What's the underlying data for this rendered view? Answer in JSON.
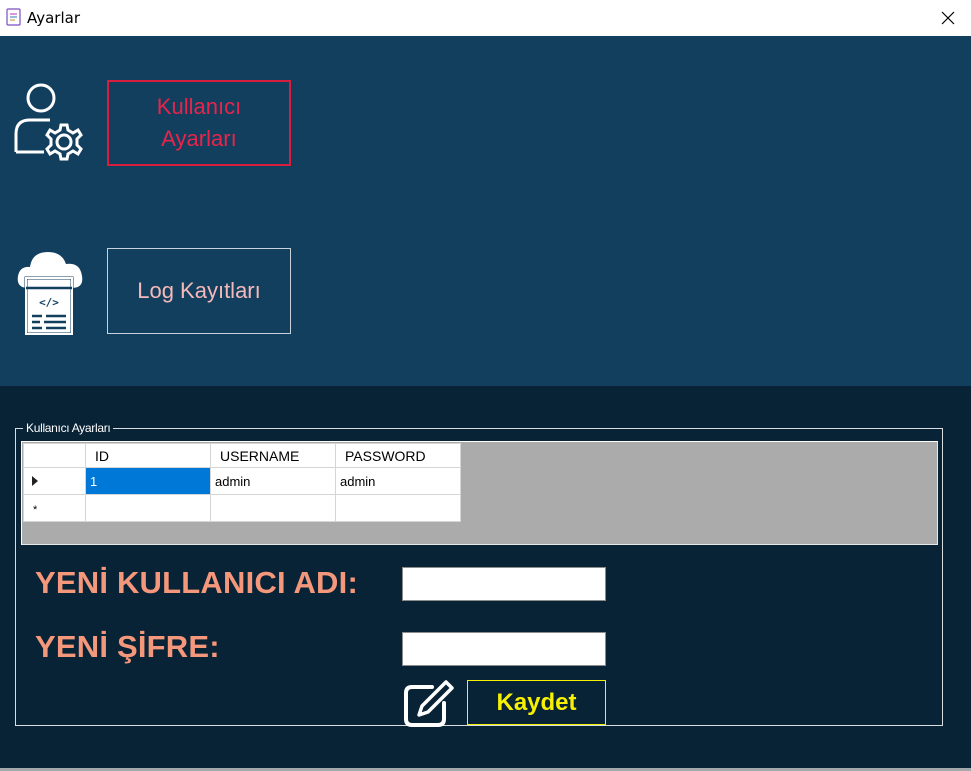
{
  "window": {
    "title": "Ayarlar",
    "close_label": "×"
  },
  "nav": {
    "user_settings_label": "Kullanıcı\nAyarları",
    "log_records_label": "Log Kayıtları",
    "user_settings_icon": "user-gear-icon",
    "log_records_icon": "cloud-code-document-icon"
  },
  "group": {
    "title": "Kullanıcı Ayarları"
  },
  "grid": {
    "columns": [
      "ID",
      "USERNAME",
      "PASSWORD"
    ],
    "rows": [
      {
        "id": "1",
        "username": "admin",
        "password": "admin"
      }
    ],
    "new_row_marker": "*"
  },
  "form": {
    "new_username_label": "YENİ KULLANICI ADI:",
    "new_password_label": "YENİ ŞİFRE:",
    "new_username_value": "",
    "new_password_value": "",
    "save_label": "Kaydet",
    "edit_icon": "edit-icon"
  },
  "colors": {
    "top_panel": "#133f5f",
    "bottom_panel": "#082236",
    "active_nav_border": "#d81e3f",
    "label_color": "#f4977a",
    "save_accent": "#f5f000",
    "selection": "#0078d7"
  }
}
